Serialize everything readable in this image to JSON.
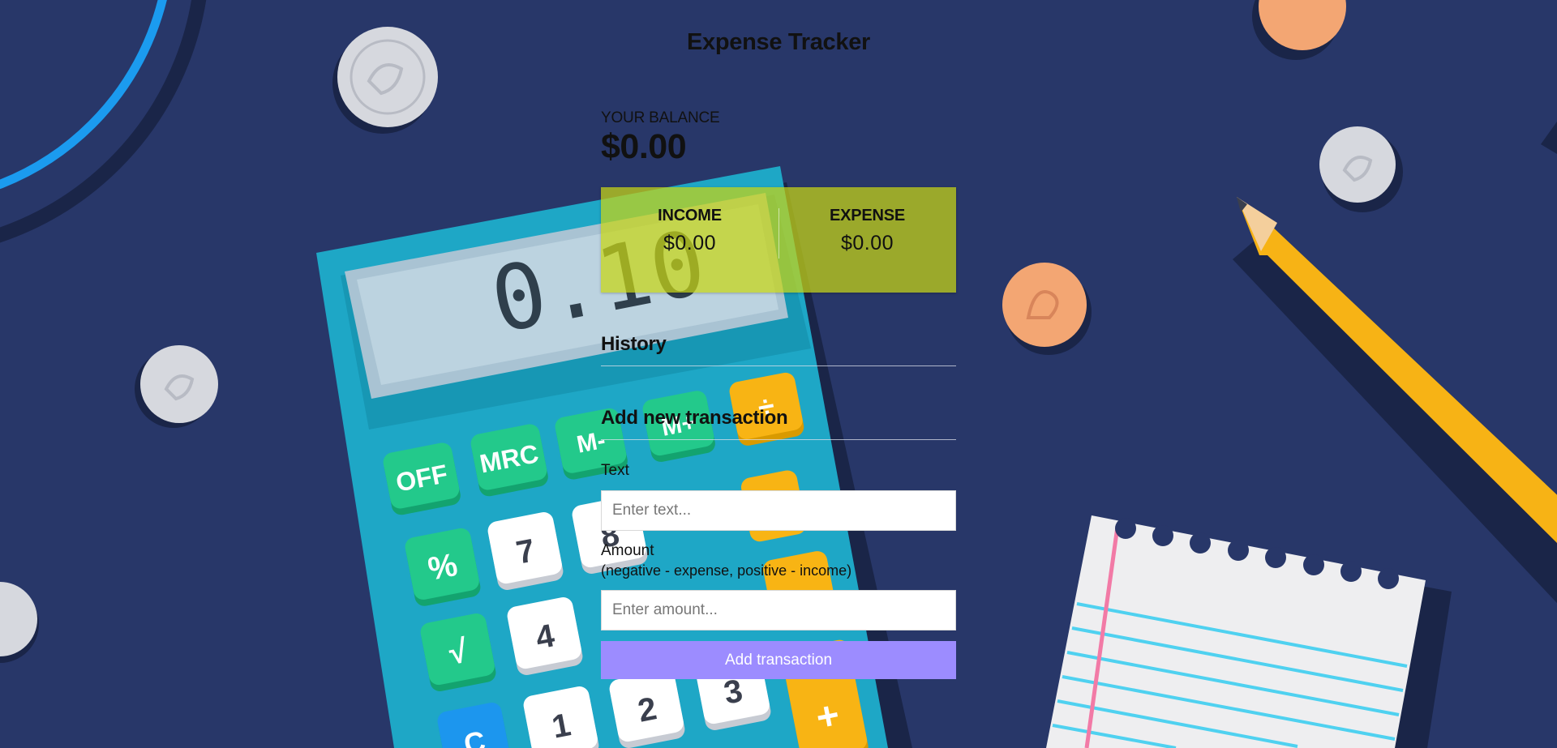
{
  "app": {
    "title": "Expense Tracker"
  },
  "balance": {
    "label": "YOUR BALANCE",
    "value": "$0.00"
  },
  "summary": {
    "income_label": "INCOME",
    "income_value": "$0.00",
    "expense_label": "EXPENSE",
    "expense_value": "$0.00",
    "panel_color": "#c8d614"
  },
  "history": {
    "heading": "History"
  },
  "form": {
    "heading": "Add new transaction",
    "text_label": "Text",
    "text_placeholder": "Enter text...",
    "amount_label": "Amount",
    "amount_hint": "(negative - expense, positive - income)",
    "amount_placeholder": "Enter amount...",
    "submit_label": "Add transaction",
    "submit_color": "#9c8cff"
  },
  "background": {
    "color": "#283769",
    "illustration": [
      "calculator",
      "coins",
      "pencil",
      "notebook-paper",
      "arcs"
    ],
    "calculator_display": "0.10",
    "calculator_keys": [
      "OFF",
      "MRC",
      "M-",
      "M+",
      "÷",
      "%",
      "7",
      "8",
      "√",
      "4",
      "1",
      "2",
      "3",
      "+",
      "C"
    ]
  }
}
